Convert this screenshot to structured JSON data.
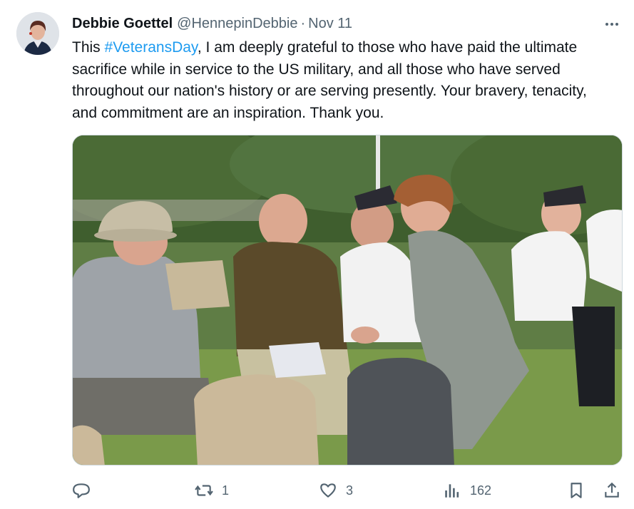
{
  "author": {
    "name": "Debbie Goettel",
    "handle": "@HennepinDebbie",
    "separator": "·",
    "date": "Nov 11"
  },
  "tweet": {
    "text_before": "This ",
    "hashtag": "#VeteransDay",
    "text_after": ", I am deeply grateful to those who have paid the ultimate sacrifice while in service to the US military, and all those who have served throughout our nation's history or are serving presently. Your bravery, tenacity, and commitment are an inspiration. Thank you."
  },
  "actions": {
    "reply_icon": "reply-icon",
    "retweet_count": "1",
    "like_count": "3",
    "views_count": "162"
  },
  "colors": {
    "link": "#1d9bf0",
    "secondary_text": "#536471",
    "primary_text": "#0f1419"
  }
}
